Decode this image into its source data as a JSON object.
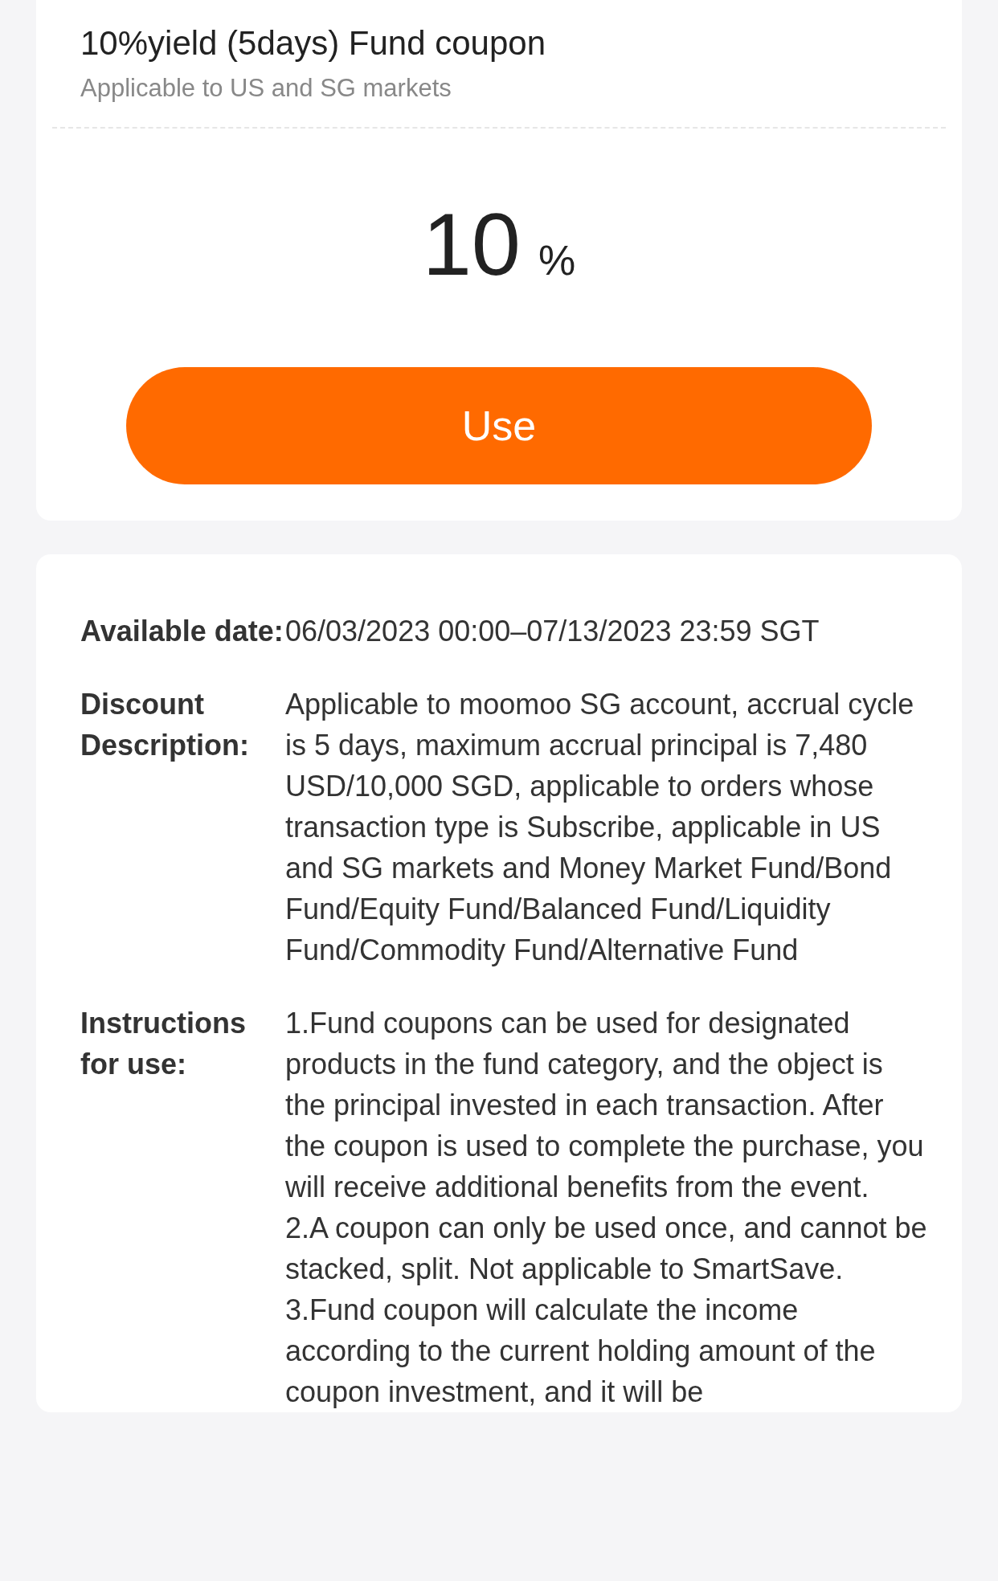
{
  "coupon": {
    "title": "10%yield (5days) Fund coupon",
    "subtitle": "Applicable to US and SG markets",
    "value": "10",
    "unit": "%",
    "button": "Use"
  },
  "details": [
    {
      "label": "Available date:",
      "paragraphs": [
        "06/03/2023 00:00–07/13/2023 23:59 SGT"
      ]
    },
    {
      "label": "Discount Description:",
      "paragraphs": [
        "Applicable to moomoo SG account, accrual cycle is 5 days, maximum accrual principal is 7,480 USD/10,000 SGD, applicable to orders whose transaction type is Subscribe, applicable in US and SG markets and Money Market Fund/Bond Fund/Equity Fund/Balanced Fund/Liquidity Fund/Commodity Fund/Alternative Fund"
      ]
    },
    {
      "label": "Instructions for use:",
      "paragraphs": [
        "1.Fund coupons can be used for designated products in the fund category, and the object is the principal invested in each transaction. After the coupon is used to complete the purchase, you will receive additional benefits from the event.",
        "2.A coupon can only be used once, and cannot be stacked, split. Not applicable to SmartSave.",
        "3.Fund coupon will calculate the income according to the current holding amount of the coupon investment, and it will be"
      ]
    }
  ]
}
